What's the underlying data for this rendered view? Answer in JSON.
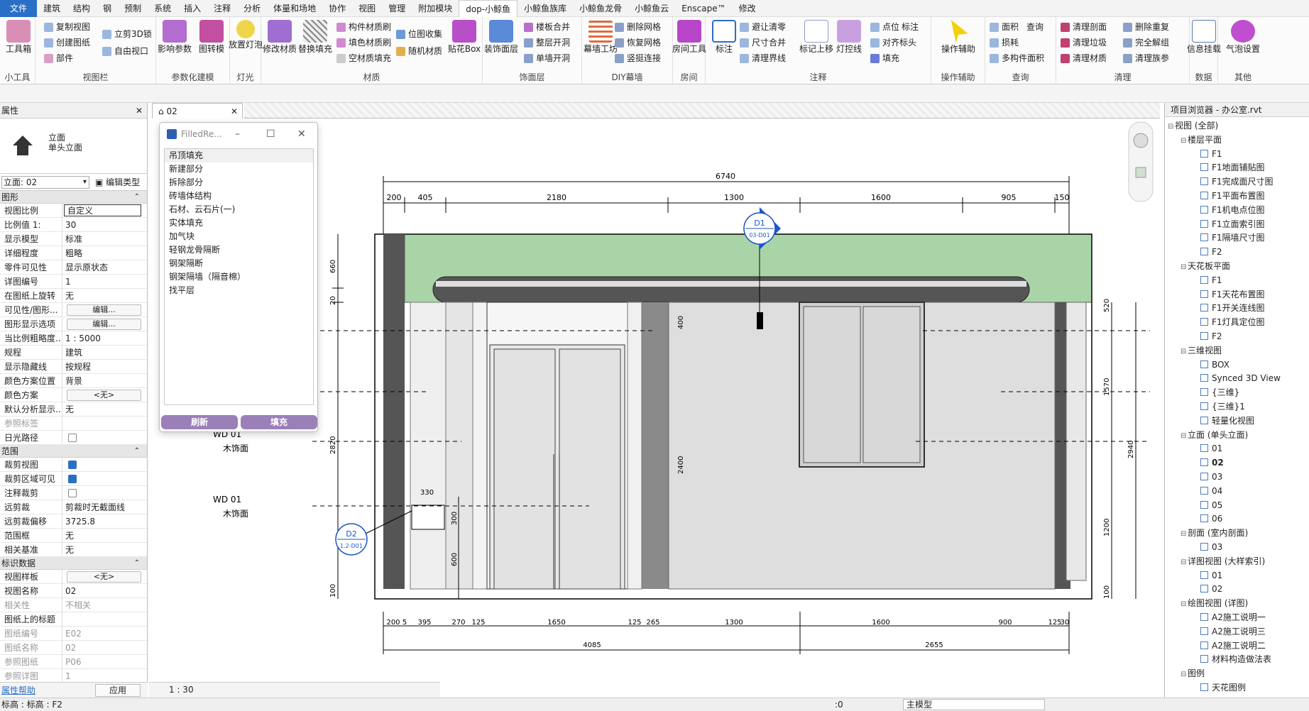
{
  "menu": [
    "文件",
    "建筑",
    "结构",
    "钢",
    "预制",
    "系统",
    "插入",
    "注释",
    "分析",
    "体量和场地",
    "协作",
    "视图",
    "管理",
    "附加模块",
    "dop-小鲸鱼",
    "小鲸鱼族库",
    "小鲸鱼龙骨",
    "小鲸鱼云",
    "Enscape™",
    "修改"
  ],
  "ribbon": {
    "panels": [
      "小工具",
      "视图栏",
      "参数化建模",
      "灯光",
      "材质",
      "饰面层",
      "DIY幕墙",
      "房间",
      "注释",
      "操作辅助",
      "查询",
      "清理",
      "数据",
      "其他"
    ],
    "big_buttons": [
      "工具箱",
      "影响参数",
      "图转模",
      "放置灯泡",
      "修改材质",
      "替换填充",
      "贴花Box",
      "装饰面层",
      "幕墙工坊",
      "房间工具",
      "标注",
      "标记上移",
      "灯控线",
      "操作辅助",
      "信息挂载",
      "气泡设置"
    ],
    "small_buttons": [
      "复制视图",
      "创建图纸",
      "部件",
      "立剪3D锁",
      "自由视口",
      "构件材质刷",
      "填色材质刷",
      "空材质填充",
      "位图收集",
      "随机材质",
      "楼板合并",
      "整层开洞",
      "单墙开洞",
      "删除网格",
      "恢复网格",
      "竖挺连接",
      "避让清零",
      "尺寸合并",
      "清理界线",
      "点位",
      "标注",
      "对齐标头",
      "填充",
      "面积",
      "查询",
      "损耗",
      "多构件面积",
      "清理剖面",
      "清理垃圾",
      "清理材质",
      "删除重复",
      "完全解组",
      "清理族参"
    ]
  },
  "properties": {
    "title": "属性",
    "type_line1": "立面",
    "type_line2": "单头立面",
    "selector": "立面: 02",
    "edit_type": "编辑类型",
    "groups": [
      {
        "name": "图形",
        "rows": [
          {
            "k": "视图比例",
            "v": "自定义",
            "box": true
          },
          {
            "k": "比例值 1:",
            "v": "30"
          },
          {
            "k": "显示模型",
            "v": "标准"
          },
          {
            "k": "详细程度",
            "v": "粗略"
          },
          {
            "k": "零件可见性",
            "v": "显示原状态"
          },
          {
            "k": "详图编号",
            "v": "1"
          },
          {
            "k": "在图纸上旋转",
            "v": "无"
          },
          {
            "k": "可见性/图形...",
            "v": "编辑...",
            "btn": true
          },
          {
            "k": "图形显示选项",
            "v": "编辑...",
            "btn": true
          },
          {
            "k": "当比例粗略度...",
            "v": "1 : 5000"
          },
          {
            "k": "规程",
            "v": "建筑"
          },
          {
            "k": "显示隐藏线",
            "v": "按规程"
          },
          {
            "k": "颜色方案位置",
            "v": "背景"
          },
          {
            "k": "颜色方案",
            "v": "<无>",
            "btn": true
          },
          {
            "k": "默认分析显示...",
            "v": "无"
          },
          {
            "k": "参照标签",
            "v": "",
            "dim": true
          },
          {
            "k": "日光路径",
            "v": "",
            "cb": "off"
          }
        ]
      },
      {
        "name": "范围",
        "rows": [
          {
            "k": "裁剪视图",
            "v": "",
            "cb": "on"
          },
          {
            "k": "裁剪区域可见",
            "v": "",
            "cb": "on"
          },
          {
            "k": "注释裁剪",
            "v": "",
            "cb": "off"
          },
          {
            "k": "远剪裁",
            "v": "剪裁时无截面线"
          },
          {
            "k": "远剪裁偏移",
            "v": "3725.8"
          },
          {
            "k": "范围框",
            "v": "无"
          },
          {
            "k": "相关基准",
            "v": "无"
          }
        ]
      },
      {
        "name": "标识数据",
        "rows": [
          {
            "k": "视图样板",
            "v": "<无>",
            "btn": true
          },
          {
            "k": "视图名称",
            "v": "02"
          },
          {
            "k": "相关性",
            "v": "不相关",
            "dim": true
          },
          {
            "k": "图纸上的标题",
            "v": ""
          },
          {
            "k": "图纸编号",
            "v": "E02",
            "dim": true
          },
          {
            "k": "图纸名称",
            "v": "02",
            "dim": true
          },
          {
            "k": "参照图纸",
            "v": "P06",
            "dim": true
          },
          {
            "k": "参照详图",
            "v": "1",
            "dim": true
          }
        ]
      }
    ],
    "help": "属性帮助",
    "apply": "应用"
  },
  "view_tab": {
    "label": "02"
  },
  "dialog": {
    "title": "FilledRe...",
    "items": [
      "吊顶填充",
      "新建部分",
      "拆除部分",
      "砖墙体结构",
      "石材、云石片(一)",
      "实体填充",
      "加气块",
      "轻钢龙骨隔断",
      "钢架隔断",
      "钢架隔墙（隔音棉）",
      "找平层"
    ],
    "refresh": "刷新",
    "fill": "填充"
  },
  "drawing": {
    "dims_top": {
      "total": "6740",
      "segs": [
        "200",
        "405",
        "2180",
        "1300",
        "1600",
        "905",
        "150"
      ]
    },
    "dims_bottom": {
      "segs": [
        "200",
        "5",
        "395",
        "270",
        "125",
        "1650",
        "125",
        "265",
        "1300",
        "1600",
        "900",
        "125",
        "30"
      ],
      "totals": [
        "4085",
        "2655"
      ]
    },
    "dims_left": [
      "660",
      "20",
      "2820",
      "300",
      "600",
      "100",
      "330"
    ],
    "dims_mid": [
      "400",
      "2400"
    ],
    "dims_right": [
      "520",
      "1570",
      "1200",
      "100",
      "2940"
    ],
    "tags": [
      {
        "num": "D1",
        "ref": "03-D01"
      },
      {
        "num": "D2",
        "ref": "1.2-D01"
      }
    ],
    "notes": [
      {
        "code": "WD   01",
        "text": "木饰面"
      },
      {
        "code": "WD   01",
        "text": "木饰面"
      }
    ]
  },
  "view_bar": {
    "scale": "1 : 30"
  },
  "browser": {
    "title": "项目浏览器 - 办公室.rvt",
    "root": "视图 (全部)",
    "groups": [
      {
        "name": "楼层平面",
        "items": [
          "F1",
          "F1地面铺贴图",
          "F1完成面尺寸图",
          "F1平面布置图",
          "F1机电点位图",
          "F1立面索引图",
          "F1隔墙尺寸图",
          "F2"
        ]
      },
      {
        "name": "天花板平面",
        "items": [
          "F1",
          "F1天花布置图",
          "F1开关连线图",
          "F1灯具定位图",
          "F2"
        ]
      },
      {
        "name": "三维视图",
        "items": [
          "BOX",
          "Synced 3D View",
          "{三维}",
          "{三维}1",
          "轻量化视图"
        ]
      },
      {
        "name": "立面 (单头立面)",
        "items": [
          "01",
          "02",
          "03",
          "04",
          "05",
          "06"
        ],
        "selected": "02"
      },
      {
        "name": "剖面 (室内剖面)",
        "items": [
          "03"
        ]
      },
      {
        "name": "详图视图 (大样索引)",
        "items": [
          "01",
          "02"
        ]
      },
      {
        "name": "绘图视图 (详图)",
        "items": [
          "A2施工说明一",
          "A2施工说明三",
          "A2施工说明二",
          "材料构造做法表"
        ]
      },
      {
        "name": "图例",
        "items": [
          "天花图例"
        ]
      }
    ]
  },
  "status": {
    "left": "标高 : 标高 : F2",
    "zero": ":0",
    "model": "主模型"
  },
  "colors": {
    "accent": "#2a6fc6",
    "ceiling_fill": "#a9d4a8",
    "dialog_button": "#9b7fb8",
    "tag_blue": "#1f56c8"
  }
}
